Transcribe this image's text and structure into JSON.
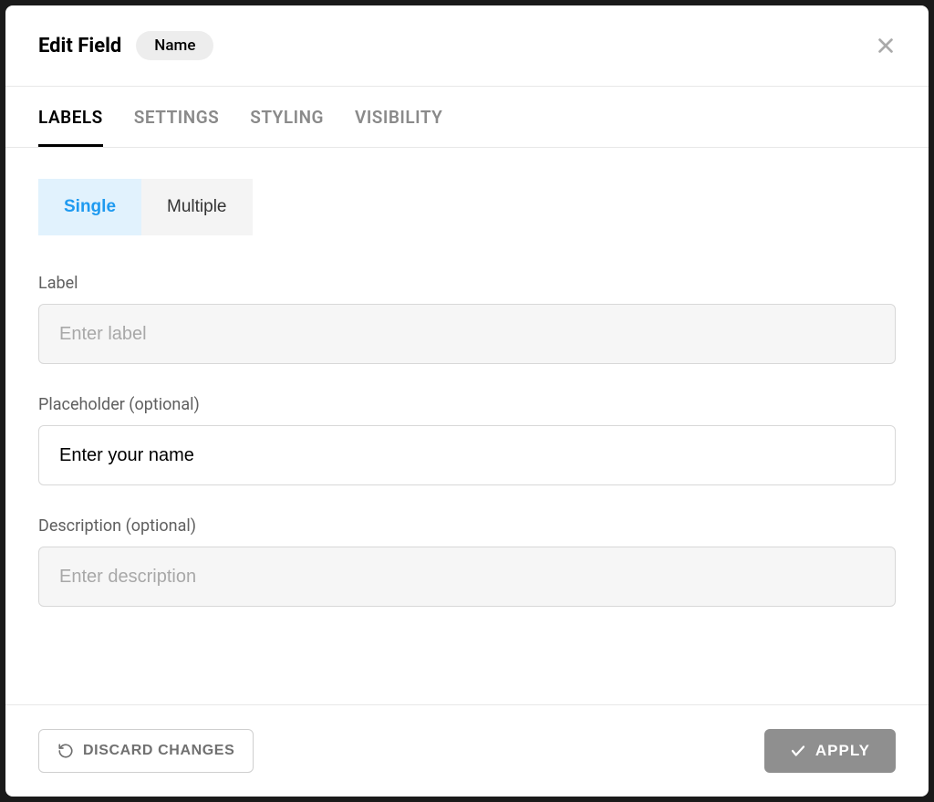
{
  "header": {
    "title": "Edit Field",
    "chip": "Name"
  },
  "tabs": {
    "labels": "LABELS",
    "settings": "SETTINGS",
    "styling": "STYLING",
    "visibility": "VISIBILITY"
  },
  "toggle": {
    "single": "Single",
    "multiple": "Multiple"
  },
  "fields": {
    "label": {
      "label": "Label",
      "placeholder": "Enter label",
      "value": ""
    },
    "placeholder": {
      "label": "Placeholder (optional)",
      "placeholder": "",
      "value": "Enter your name"
    },
    "description": {
      "label": "Description (optional)",
      "placeholder": "Enter description",
      "value": ""
    }
  },
  "footer": {
    "discard": "DISCARD CHANGES",
    "apply": "APPLY"
  }
}
